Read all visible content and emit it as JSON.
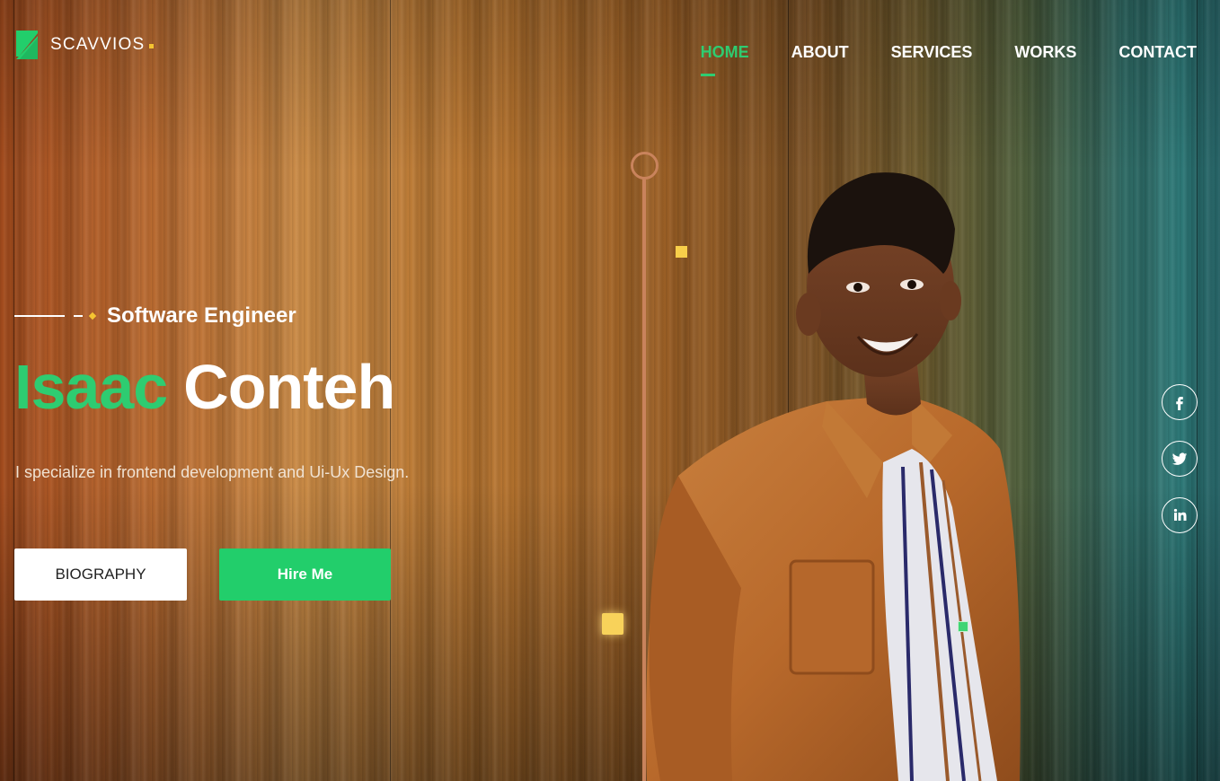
{
  "brand": {
    "name": "SCAVVIOS",
    "icon": "brand-logo-icon",
    "accent_color": "#2ecc71",
    "dot_color": "#f5c431"
  },
  "nav": {
    "items": [
      {
        "label": "HOME",
        "active": true
      },
      {
        "label": "ABOUT",
        "active": false
      },
      {
        "label": "SERVICES",
        "active": false
      },
      {
        "label": "WORKS",
        "active": false
      },
      {
        "label": "CONTACT",
        "active": false
      }
    ]
  },
  "hero": {
    "subtitle": "Software Engineer",
    "first_name": "Isaac",
    "last_name": "Conteh",
    "tagline": "I specialize in frontend development and Ui-Ux Design.",
    "buttons": {
      "biography": "BIOGRAPHY",
      "hire": "Hire Me"
    }
  },
  "social": [
    {
      "icon": "facebook-icon"
    },
    {
      "icon": "twitter-icon"
    },
    {
      "icon": "linkedin-icon"
    }
  ],
  "colors": {
    "primary_green": "#22ce6b",
    "highlight_yellow": "#f8cf4a",
    "deco_copper": "#c9835c"
  }
}
